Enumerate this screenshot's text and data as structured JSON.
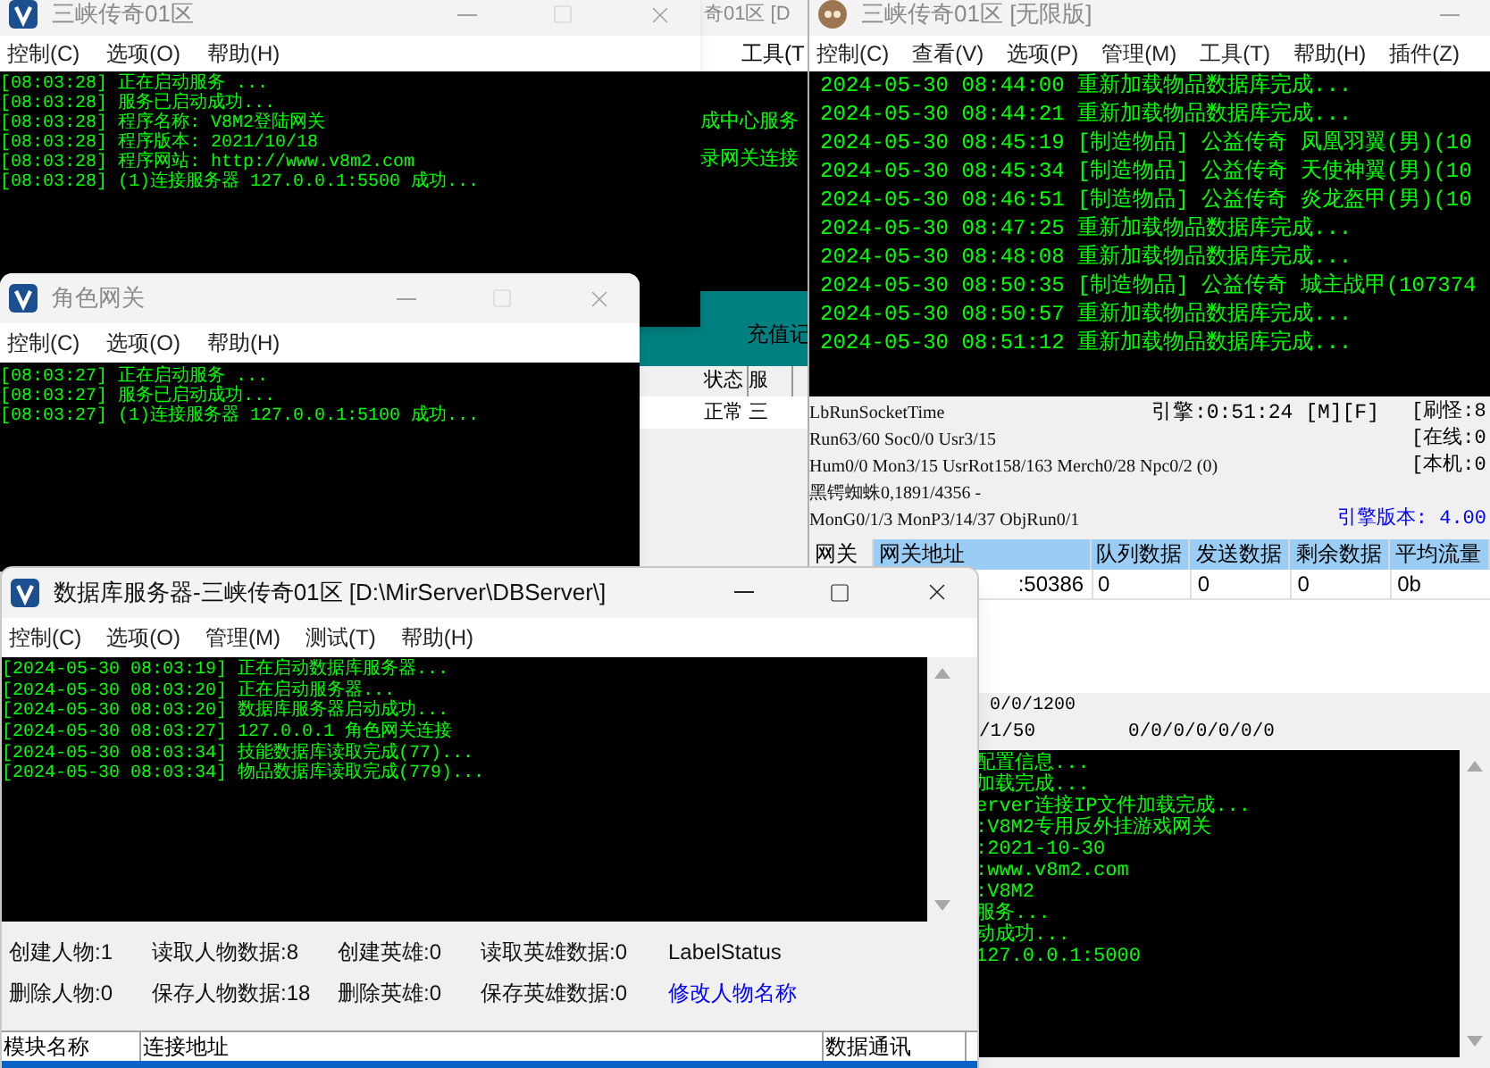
{
  "back_window": {
    "active": false,
    "title": "奇01区 [D",
    "menu": [
      "工具(T"
    ],
    "log": [
      "成中心服务",
      "录网关连接"
    ],
    "tab": "充值记",
    "table": {
      "columns": [
        "状态",
        "服"
      ],
      "rows": [
        [
          "正常",
          "三"
        ]
      ]
    }
  },
  "engine_window": {
    "active": false,
    "title": "三峡传奇01区 [无限版]",
    "menu": [
      "控制(C)",
      "查看(V)",
      "选项(P)",
      "管理(M)",
      "工具(T)",
      "帮助(H)",
      "插件(Z)"
    ],
    "log": [
      "2024-05-30 08:44:00 重新加载物品数据库完成...",
      "2024-05-30 08:44:21 重新加载物品数据库完成...",
      "2024-05-30 08:45:19 [制造物品] 公益传奇 凤凰羽翼(男)(10",
      "2024-05-30 08:45:34 [制造物品] 公益传奇 天使神翼(男)(10",
      "2024-05-30 08:46:51 [制造物品] 公益传奇 炎龙盔甲(男)(10",
      "2024-05-30 08:47:25 重新加载物品数据库完成...",
      "2024-05-30 08:48:08 重新加载物品数据库完成...",
      "2024-05-30 08:50:35 [制造物品] 公益传奇 城主战甲(107374",
      "2024-05-30 08:50:57 重新加载物品数据库完成...",
      "2024-05-30 08:51:12 重新加载物品数据库完成..."
    ],
    "status": {
      "left": [
        "LbRunSocketTime",
        "Run63/60 Soc0/0 Usr3/15",
        "Hum0/0 Mon3/15 UsrRot158/163 Merch0/28 Npc0/2 (0)",
        "黑锷蜘蛛0,1891/4356 -",
        "MonG0/1/3 MonP3/14/37 ObjRun0/1"
      ],
      "engine_time": "引擎:0:51:24 [M][F]",
      "right": [
        "[刷怪:8",
        "[在线:0",
        "[本机:0"
      ],
      "version": "引擎版本: 4.00"
    },
    "table": {
      "columns": [
        "网关",
        "网关地址",
        "队列数据",
        "发送数据",
        "剩余数据",
        "平均流量"
      ],
      "rows": [
        {
          "address": ":50386",
          "queue": "0",
          "sent": "0",
          "remaining": "0",
          "average": "0b"
        }
      ]
    }
  },
  "gate_window": {
    "status": [
      "0/0/1200"
    ],
    "counters": [
      "/1/50",
      "0/0/0/0/0/0/0"
    ],
    "log": [
      "配置信息...",
      "加载完成...",
      "erver连接IP文件加载完成...",
      ":V8M2专用反外挂游戏网关",
      ":2021-10-30",
      ":www.v8m2.com",
      ":V8M2",
      "服务...",
      "动成功...",
      "127.0.0.1:5000"
    ]
  },
  "login_gateway": {
    "active": false,
    "title": "三峡传奇01区",
    "menu": [
      "控制(C)",
      "选项(O)",
      "帮助(H)"
    ],
    "log": [
      "[08:03:28] 正在启动服务 ...",
      "[08:03:28] 服务已启动成功...",
      "[08:03:28] 程序名称: V8M2登陆网关",
      "[08:03:28] 程序版本: 2021/10/18",
      "[08:03:28] 程序网站: http://www.v8m2.com",
      "[08:03:28] (1)连接服务器 127.0.0.1:5500 成功..."
    ]
  },
  "role_gateway": {
    "active": false,
    "title": "角色网关",
    "menu": [
      "控制(C)",
      "选项(O)",
      "帮助(H)"
    ],
    "log": [
      "[08:03:27] 正在启动服务 ...",
      "[08:03:27] 服务已启动成功...",
      "[08:03:27] (1)连接服务器 127.0.0.1:5100 成功..."
    ]
  },
  "db_server": {
    "active": true,
    "title": "数据库服务器-三峡传奇01区  [D:\\MirServer\\DBServer\\]",
    "menu": [
      "控制(C)",
      "选项(O)",
      "管理(M)",
      "测试(T)",
      "帮助(H)"
    ],
    "log": [
      "[2024-05-30 08:03:19] 正在启动数据库服务器...",
      "[2024-05-30 08:03:20] 正在启动服务器...",
      "[2024-05-30 08:03:20] 数据库服务器启动成功...",
      "[2024-05-30 08:03:27] 127.0.0.1 角色网关连接",
      "[2024-05-30 08:03:34] 技能数据库读取完成(77)...",
      "[2024-05-30 08:03:34] 物品数据库读取完成(779)..."
    ],
    "stats": [
      [
        {
          "kind": "label",
          "text": "创建人物:1"
        },
        {
          "kind": "label",
          "text": "读取人物数据:8"
        },
        {
          "kind": "label",
          "text": "创建英雄:0"
        },
        {
          "kind": "label",
          "text": "读取英雄数据:0"
        },
        {
          "kind": "label",
          "text": "LabelStatus"
        }
      ],
      [
        {
          "kind": "label",
          "text": "删除人物:0"
        },
        {
          "kind": "label",
          "text": "保存人物数据:18"
        },
        {
          "kind": "label",
          "text": "删除英雄:0"
        },
        {
          "kind": "label",
          "text": "保存英雄数据:0"
        },
        {
          "kind": "link",
          "text": "修改人物名称"
        }
      ]
    ],
    "table": {
      "columns": [
        "模块名称",
        "连接地址",
        "数据通讯"
      ]
    }
  }
}
